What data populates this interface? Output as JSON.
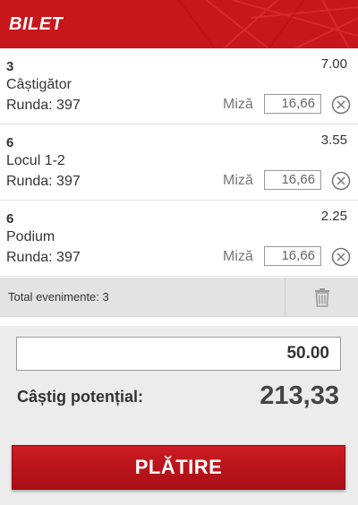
{
  "header": {
    "title": "BILET"
  },
  "bets": [
    {
      "number": "3",
      "market": "Câștigător",
      "round": "Runda: 397",
      "odds": "7.00",
      "stake_label": "Miză",
      "stake": "16,66"
    },
    {
      "number": "6",
      "market": "Locul 1-2",
      "round": "Runda: 397",
      "odds": "3.55",
      "stake_label": "Miză",
      "stake": "16,66"
    },
    {
      "number": "6",
      "market": "Podium",
      "round": "Runda: 397",
      "odds": "2.25",
      "stake_label": "Miză",
      "stake": "16,66"
    }
  ],
  "total_bar": {
    "label": "Total evenimente: 3"
  },
  "summary": {
    "amount": "50.00",
    "potential_label": "Câștig potențial:",
    "potential_value": "213,33",
    "pay_label": "PLĂTIRE"
  },
  "icons": {
    "remove": "close-circle-icon",
    "trash": "trash-icon"
  },
  "colors": {
    "brand": "#c8161d",
    "panel": "#ececec",
    "total_bar": "#e3e3e3"
  }
}
